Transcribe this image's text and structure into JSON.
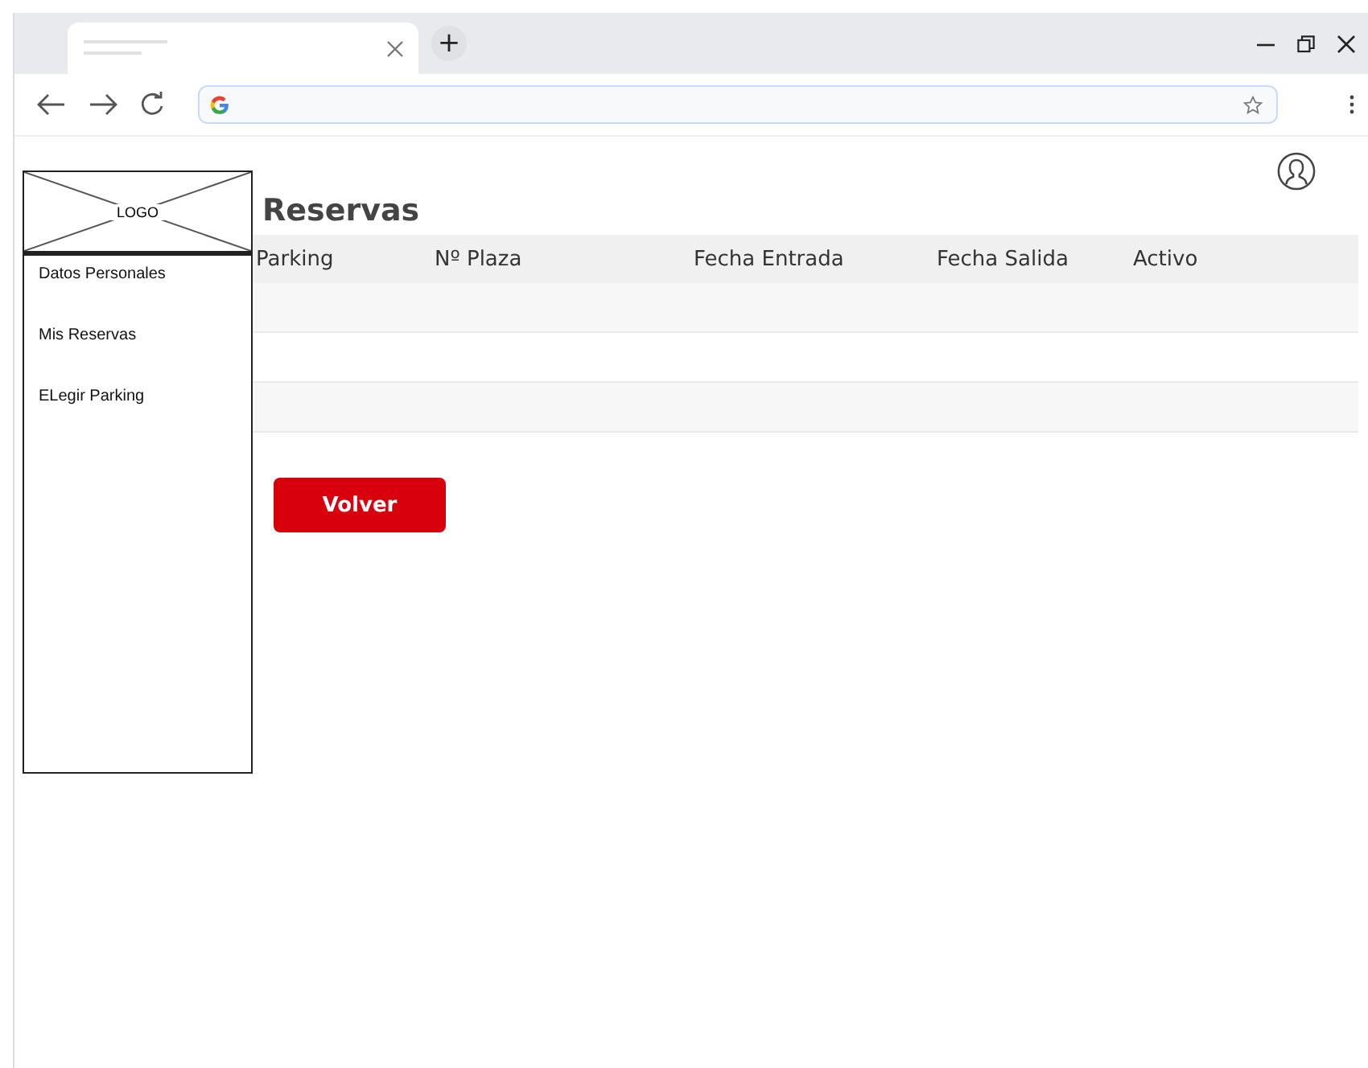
{
  "browser": {
    "new_tab": "+"
  },
  "sidebar": {
    "logo": "LOGO",
    "items": [
      {
        "label": "Datos Personales"
      },
      {
        "label": "Mis Reservas"
      },
      {
        "label": "ELegir Parking"
      }
    ]
  },
  "page": {
    "title": "Reservas"
  },
  "table": {
    "columns": [
      "Parking",
      "Nº Plaza",
      "Fecha Entrada",
      "Fecha Salida",
      "Activo"
    ]
  },
  "buttons": [
    {
      "label": "Volver"
    }
  ]
}
